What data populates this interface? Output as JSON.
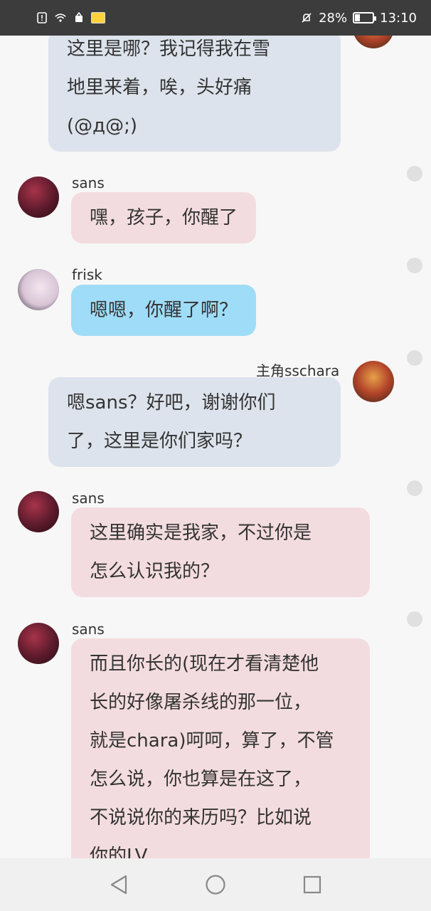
{
  "status_bar": {
    "battery_percent": "28%",
    "time": "13:10",
    "battery_level": 0.28,
    "icons": [
      "alert-icon",
      "wifi-icon",
      "app-icon",
      "mute-icon",
      "battery-icon"
    ]
  },
  "messages": [
    {
      "sender": "主角sschara",
      "side": "right",
      "lines": [
        "这里是哪？我记得我在雪",
        "地里来着，唉，头好痛",
        "(@д@;)"
      ]
    },
    {
      "sender": "sans",
      "side": "left",
      "lines": [
        "嘿，孩子，你醒了"
      ]
    },
    {
      "sender": "frisk",
      "side": "left",
      "lines": [
        "嗯嗯，你醒了啊？"
      ]
    },
    {
      "sender": "主角sschara",
      "side": "right",
      "lines": [
        "嗯sans？好吧，谢谢你们",
        "了，这里是你们家吗？"
      ]
    },
    {
      "sender": "sans",
      "side": "left",
      "lines": [
        "这里确实是我家，不过你是",
        "怎么认识我的？"
      ]
    },
    {
      "sender": "sans",
      "side": "left",
      "lines": [
        "而且你长的(现在才看清楚他",
        "长的好像屠杀线的那一位，",
        "就是chara)呵呵，算了，不管",
        "怎么说，你也算是在这了，",
        "不说说你的来历吗？比如说",
        "你的LV"
      ]
    }
  ],
  "colors": {
    "self_bubble": "#dde3ec",
    "sans_bubble": "#f3dcdf",
    "frisk_bubble": "#9fdcf8",
    "status_bar": "#3c3c3c"
  },
  "nav": {
    "icons": [
      "back-icon",
      "home-icon",
      "recents-icon"
    ]
  }
}
